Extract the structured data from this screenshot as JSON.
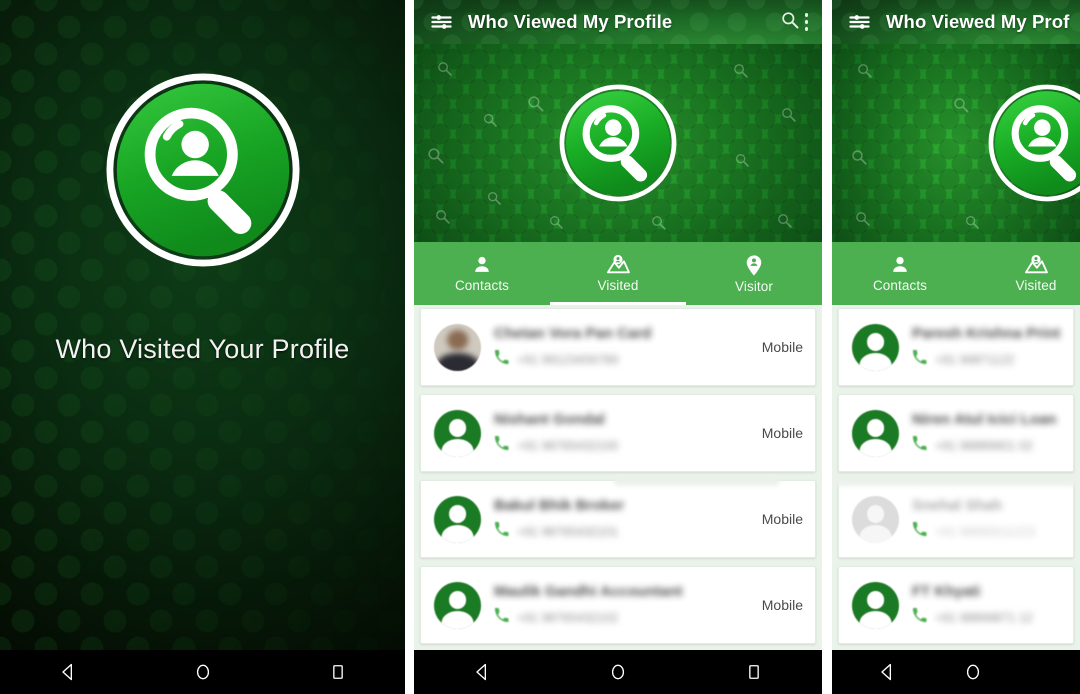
{
  "splash": {
    "title": "Who Visited Your Profile",
    "logo_icon": "profile-magnifier-logo",
    "bg_color": "#0a2c11"
  },
  "app": {
    "appbar": {
      "menu_icon": "filter-list-icon",
      "title": "Who Viewed My Profile",
      "search_icon": "search-icon",
      "overflow_icon": "more-vertical-icon",
      "accent_color": "#1d6a26"
    },
    "hero": {
      "logo_icon": "profile-magnifier-logo",
      "bg_color": "#1f8a27"
    },
    "tabs": [
      {
        "label": "Contacts",
        "icon": "person-icon",
        "active": false
      },
      {
        "label": "Visited",
        "icon": "map-person-pin-icon",
        "active": true
      },
      {
        "label": "Visitor",
        "icon": "person-pin-icon",
        "active": false
      }
    ],
    "tab_bar_color": "#4caf50",
    "list": [
      {
        "name": "Chetan Vora Pan Card",
        "number": "+91 99123456789",
        "tag": "Mobile",
        "avatar": "photo"
      },
      {
        "name": "Nishant Gondal",
        "number": "+91 98765432100",
        "tag": "Mobile",
        "avatar": "initial"
      },
      {
        "name": "Bakul Bhik Broker",
        "number": "+91 98765432101",
        "tag": "Mobile",
        "avatar": "initial"
      },
      {
        "name": "Maulik Gandhi Accountant",
        "number": "+91 98765432102",
        "tag": "Mobile",
        "avatar": "initial"
      }
    ]
  },
  "app2": {
    "appbar": {
      "menu_icon": "filter-list-icon",
      "title": "Who Viewed My Prof",
      "search_icon": "search-icon",
      "overflow_icon": "more-vertical-icon"
    },
    "tabs": [
      {
        "label": "Contacts",
        "icon": "person-icon",
        "active": false
      },
      {
        "label": "Visited",
        "icon": "map-person-pin-icon",
        "active": true
      }
    ],
    "list": [
      {
        "name": "Paresh Krishna Printer",
        "number": "+91 99871122",
        "tag": "",
        "avatar": "initial"
      },
      {
        "name": "Niren Atul Icici Loan",
        "number": "+91 98889901 02",
        "tag": "",
        "avatar": "initial"
      },
      {
        "name": "Snehal Shah",
        "number": "+91 98890011223",
        "tag": "",
        "avatar": "light"
      },
      {
        "name": "FT Khyati",
        "number": "+91 98899871 12",
        "tag": "",
        "avatar": "initial"
      }
    ]
  },
  "navbar": {
    "back_icon": "back-triangle-icon",
    "home_icon": "home-circle-icon",
    "recents_icon": "recents-square-icon"
  }
}
